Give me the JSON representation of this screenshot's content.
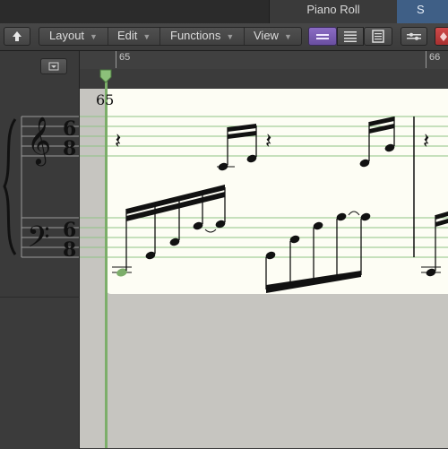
{
  "tabs": {
    "piano_roll": "Piano Roll",
    "score": "S"
  },
  "toolbar": {
    "menus": [
      "Layout",
      "Edit",
      "Functions",
      "View"
    ]
  },
  "ruler": {
    "bar_start": "65",
    "bar_next": "66"
  },
  "score": {
    "measure_number": "65",
    "time_signature_top": "6",
    "time_signature_bottom": "8"
  },
  "colors": {
    "accent_selected": "#7a5fb0",
    "tab_active": "#3f5f86",
    "playhead": "#7cae6a",
    "staff_line": "#8fc283",
    "paper": "#fdfdf4"
  },
  "icons": [
    "catch-icon",
    "view-toggle-icon",
    "staff-view-icon",
    "list-view-icon",
    "page-view-icon",
    "options-icon",
    "midi-icon",
    "playhead-icon"
  ]
}
